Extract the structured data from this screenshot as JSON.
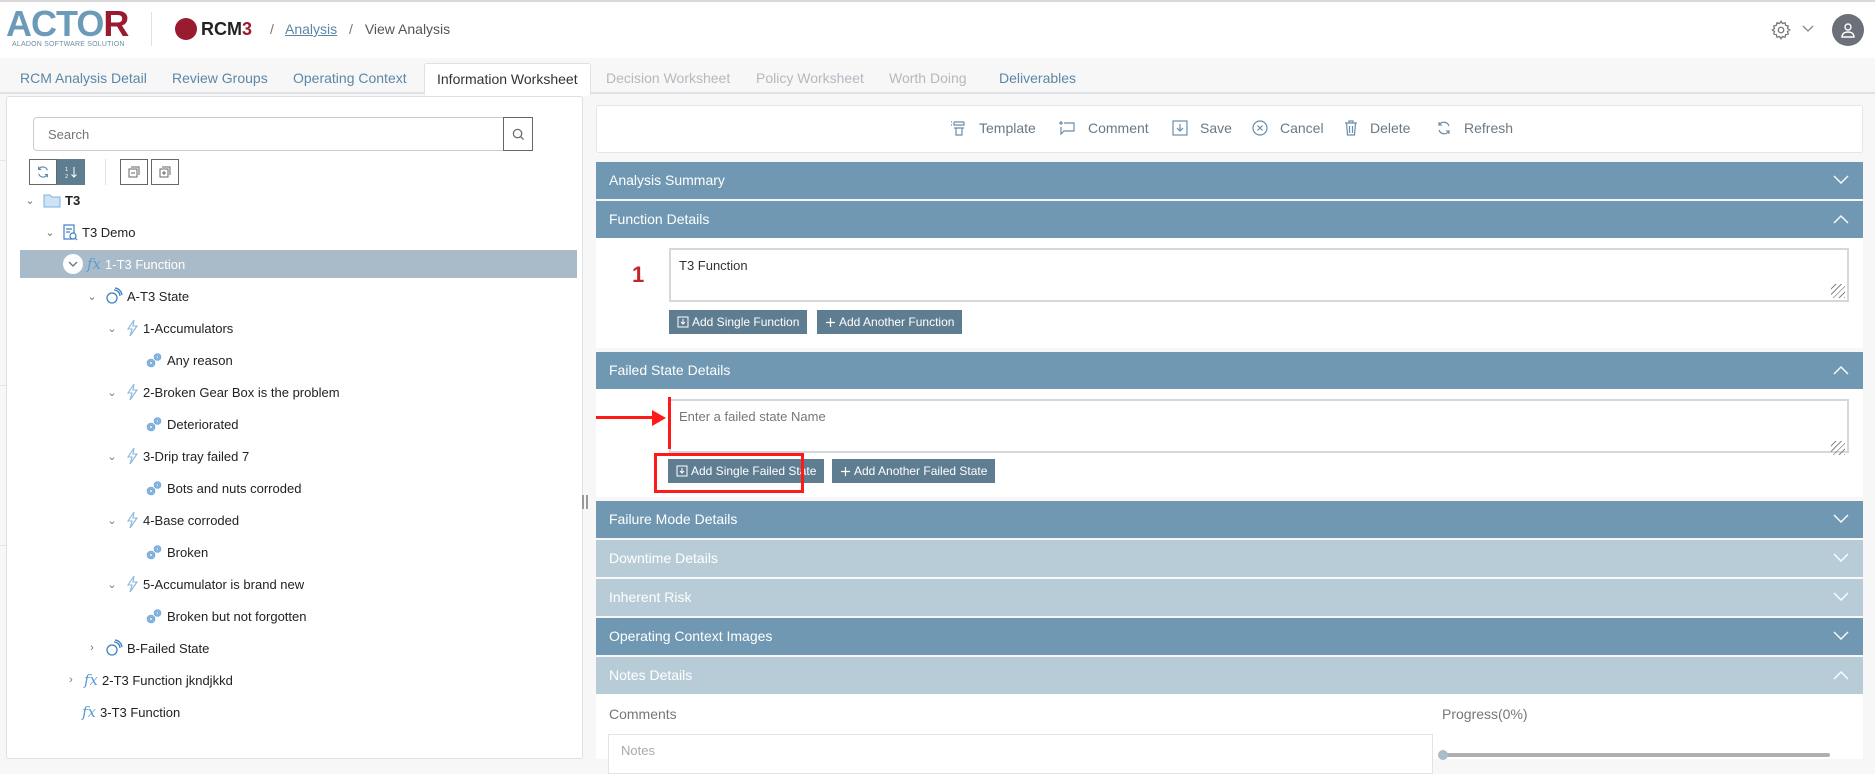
{
  "header": {
    "logo_text": "ACTOR",
    "logo_subtitle": "ALADON SOFTWARE SOLUTION",
    "product_name": "RCM",
    "product_version": "3",
    "breadcrumb": [
      {
        "label": "Analysis",
        "link": true
      },
      {
        "label": "View Analysis",
        "link": false
      }
    ],
    "breadcrumb_separator": "/",
    "icons": [
      "gear-icon",
      "chevron-down-icon",
      "user-avatar-icon"
    ]
  },
  "tabs": [
    {
      "label": "RCM Analysis Detail",
      "state": "normal"
    },
    {
      "label": "Review Groups",
      "state": "normal"
    },
    {
      "label": "Operating Context",
      "state": "normal"
    },
    {
      "label": "Information Worksheet",
      "state": "active"
    },
    {
      "label": "Decision Worksheet",
      "state": "disabled"
    },
    {
      "label": "Policy Worksheet",
      "state": "disabled"
    },
    {
      "label": "Worth Doing",
      "state": "disabled"
    },
    {
      "label": "Deliverables",
      "state": "normal"
    }
  ],
  "tree": {
    "search_placeholder": "Search",
    "toolbar": [
      "refresh-icon",
      "sort-numeric-icon",
      "collapse-all-icon",
      "expand-all-icon"
    ],
    "nodes": [
      {
        "label": "T3",
        "type": "folder",
        "expanded": true,
        "bold": true
      },
      {
        "label": "T3 Demo",
        "type": "analysis",
        "expanded": true
      },
      {
        "label": "1-T3 Function",
        "type": "function",
        "expanded": true,
        "selected": true
      },
      {
        "label": "A-T3 State",
        "type": "failed-state",
        "expanded": true
      },
      {
        "label": "1-Accumulators",
        "type": "failure-mode",
        "expanded": true
      },
      {
        "label": "Any reason",
        "type": "cause"
      },
      {
        "label": "2-Broken Gear Box is the problem",
        "type": "failure-mode",
        "expanded": true
      },
      {
        "label": "Deteriorated",
        "type": "cause"
      },
      {
        "label": "3-Drip tray failed 7",
        "type": "failure-mode",
        "expanded": true
      },
      {
        "label": "Bots and nuts corroded",
        "type": "cause"
      },
      {
        "label": "4-Base corroded",
        "type": "failure-mode",
        "expanded": true
      },
      {
        "label": "Broken",
        "type": "cause"
      },
      {
        "label": "5-Accumulator is brand new",
        "type": "failure-mode",
        "expanded": true
      },
      {
        "label": "Broken but not forgotten",
        "type": "cause"
      },
      {
        "label": "B-Failed State",
        "type": "failed-state",
        "expanded": false
      },
      {
        "label": "2-T3 Function jkndjkkd",
        "type": "function",
        "expanded": false
      },
      {
        "label": "3-T3 Function",
        "type": "function"
      }
    ]
  },
  "actions": [
    {
      "label": "Template",
      "icon": "template-icon"
    },
    {
      "label": "Comment",
      "icon": "comment-icon"
    },
    {
      "label": "Save",
      "icon": "save-icon"
    },
    {
      "label": "Cancel",
      "icon": "cancel-icon"
    },
    {
      "label": "Delete",
      "icon": "trash-icon"
    },
    {
      "label": "Refresh",
      "icon": "refresh-icon"
    }
  ],
  "sections": {
    "analysis_summary": {
      "title": "Analysis Summary",
      "expanded": false
    },
    "function_details": {
      "title": "Function Details",
      "expanded": true,
      "index": "1",
      "value": "T3 Function",
      "add_single": "Add Single Function",
      "add_another": "Add Another Function"
    },
    "failed_state_details": {
      "title": "Failed State Details",
      "expanded": true,
      "placeholder": "Enter a failed state Name",
      "value": "",
      "add_single": "Add Single Failed State",
      "add_another": "Add Another Failed State"
    },
    "failure_mode_details": {
      "title": "Failure Mode Details",
      "expanded": false
    },
    "downtime_details": {
      "title": "Downtime Details",
      "expanded": false,
      "disabled": true
    },
    "inherent_risk": {
      "title": "Inherent Risk",
      "expanded": false,
      "disabled": true
    },
    "operating_context_images": {
      "title": "Operating Context Images",
      "expanded": false
    },
    "notes_details": {
      "title": "Notes Details",
      "expanded": true,
      "disabled": true,
      "comments_label": "Comments",
      "notes_placeholder": "Notes",
      "progress_label": "Progress(0%)",
      "progress_value": 0
    }
  },
  "annotations": {
    "highlight_color": "#ff1a1a",
    "highlighted_element": "Add Single Failed State",
    "arrow_target": "failed state input"
  },
  "colors": {
    "accent": "#7098b2",
    "accent_light": "#b8ccd8",
    "button": "#5f7d91",
    "brand_red": "#9a1b2f",
    "link": "#5b87a6"
  }
}
